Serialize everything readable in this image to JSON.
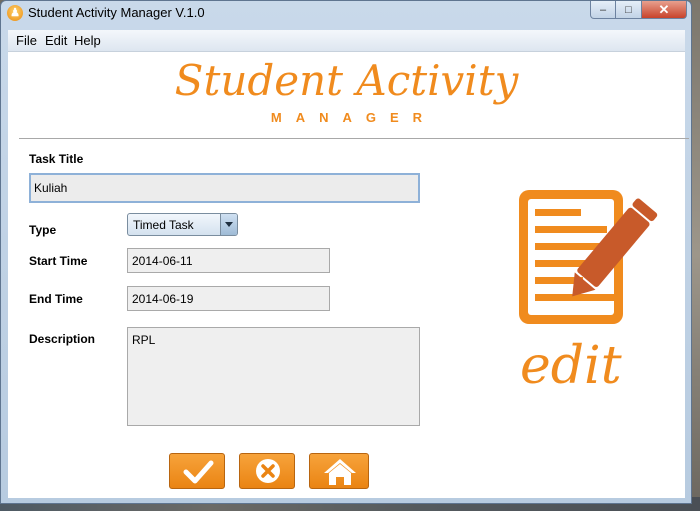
{
  "window": {
    "title": "Student Activity Manager V.1.0",
    "minimize_glyph": "–",
    "maximize_glyph": "□",
    "close_glyph": "✕"
  },
  "menu": [
    "File",
    "Edit",
    "Help"
  ],
  "logo": {
    "main": "Student Activity",
    "sub": "MANAGER"
  },
  "form": {
    "task_title_label": "Task Title",
    "task_title_value": "Kuliah",
    "type_label": "Type",
    "type_value": "Timed Task",
    "start_label": "Start Time",
    "start_value": "2014-06-11",
    "end_label": "End Time",
    "end_value": "2014-06-19",
    "description_label": "Description",
    "description_value": "RPL"
  },
  "art": {
    "edit_text": "edit",
    "icon": "document-pencil-icon"
  },
  "buttons": {
    "confirm_icon": "checkmark-icon",
    "cancel_icon": "x-circle-icon",
    "home_icon": "home-icon"
  },
  "colors": {
    "accent": "#f08b1e",
    "button": "#ea8413",
    "pencil": "#c85a2a"
  }
}
